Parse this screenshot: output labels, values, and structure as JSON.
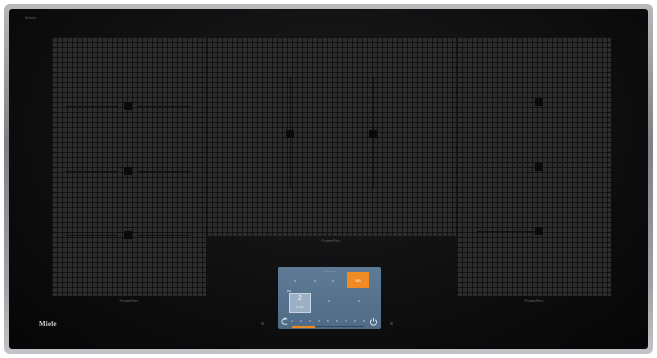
{
  "device": {
    "brand_logo": "Miele",
    "corner_label": "Miele"
  },
  "zones": {
    "left_label": "PowerFlex",
    "middle_label": "PowerFlex",
    "right_label": "PowerFlex"
  },
  "display": {
    "top_text": "— — —",
    "boost_label": "BR",
    "selected_zone": {
      "tag": "BR",
      "level": "2",
      "sub": "3 min"
    },
    "scale": [
      "1",
      "2",
      "3",
      "4",
      "5",
      "6",
      "7",
      "8",
      "9"
    ],
    "active_level_fraction": 0.32,
    "accent_color": "#f08a24",
    "screen_color": "#5a7690",
    "icons": {
      "back": "back-arrow-icon",
      "power": "power-icon"
    }
  },
  "colors": {
    "zone_fill": "#2c2c2e",
    "glass": "#0c0c0d",
    "frame": "#9ea1a5"
  }
}
